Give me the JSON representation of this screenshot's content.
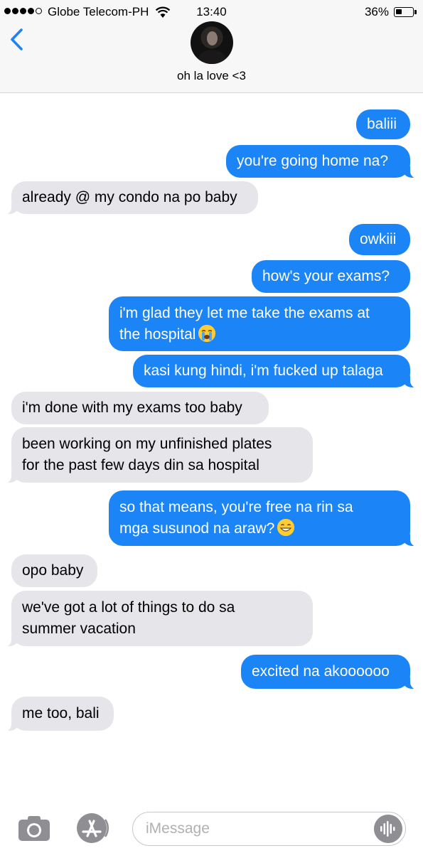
{
  "status_bar": {
    "carrier": "Globe Telecom-PH",
    "time": "13:40",
    "battery_percent": "36%",
    "signal_bars": 4,
    "battery_level": 0.36
  },
  "header": {
    "contact_name": "oh la love <3",
    "back_icon": "chevron-left-icon",
    "accent_color": "#1b84f7"
  },
  "messages": [
    {
      "from": "me",
      "text": "baliii"
    },
    {
      "from": "me",
      "text": "you're going home na?"
    },
    {
      "from": "them",
      "text": "already @ my condo na po baby"
    },
    {
      "from": "me",
      "text": "owkiii"
    },
    {
      "from": "me",
      "text": "how's your exams?"
    },
    {
      "from": "me",
      "text": "i'm glad they let me take the exams at\nthe hospital",
      "emoji": "loudly-crying-face"
    },
    {
      "from": "me",
      "text": "kasi kung hindi, i'm fucked up talaga"
    },
    {
      "from": "them",
      "text": "i'm done with my exams too baby"
    },
    {
      "from": "them",
      "text": "been working on my unfinished plates\nfor the past few days din sa hospital"
    },
    {
      "from": "me",
      "text": "so that means, you're free na rin sa\nmga susunod na araw?",
      "emoji": "grinning-face"
    },
    {
      "from": "them",
      "text": "opo baby"
    },
    {
      "from": "them",
      "text": "we've got a lot of things to do sa\nsummer vacation"
    },
    {
      "from": "me",
      "text": "excited na akoooooo"
    },
    {
      "from": "them",
      "text": "me too, bali"
    }
  ],
  "composer": {
    "placeholder": "iMessage",
    "camera_icon": "camera-icon",
    "apps_icon": "app-store-icon",
    "audio_icon": "audio-waveform-icon"
  },
  "colors": {
    "sent_bubble": "#1b84f7",
    "received_bubble": "#e5e5ea"
  }
}
